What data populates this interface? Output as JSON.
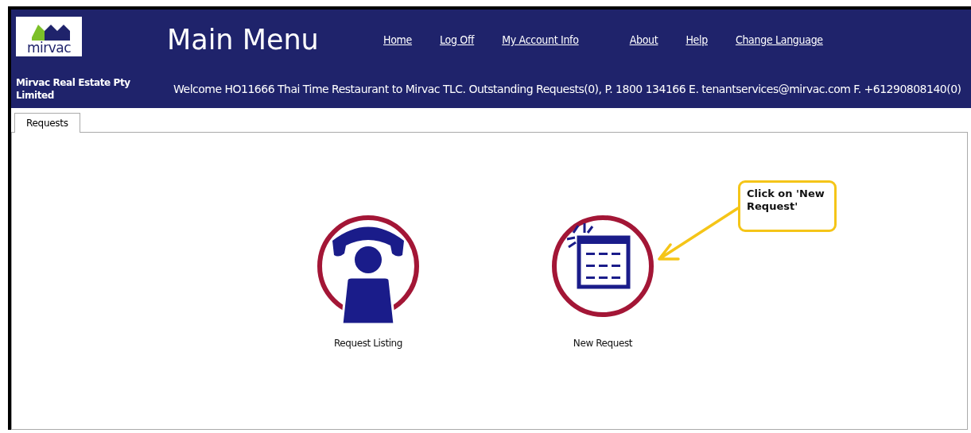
{
  "header": {
    "logo": {
      "text": "mirvac"
    },
    "title": "Main Menu",
    "nav_links": [
      {
        "label": "Home"
      },
      {
        "label": "Log Off"
      },
      {
        "label": "My Account Info"
      },
      {
        "label": "About"
      },
      {
        "label": "Help"
      },
      {
        "label": "Change Language"
      }
    ],
    "company": "Mirvac Real Estate Pty Limited",
    "welcome": "Welcome HO11666 Thai Time Restaurant to Mirvac TLC. Outstanding Requests(0), P. 1800 134166 E. tenantservices@mirvac.com F. +61290808140(0)"
  },
  "tabs": [
    {
      "label": "Requests",
      "selected": true
    }
  ],
  "tiles": [
    {
      "kind": "phone",
      "label": "Request Listing"
    },
    {
      "kind": "calendar",
      "label": "New Request"
    }
  ],
  "callout": {
    "text": "Click on 'New Request'"
  }
}
